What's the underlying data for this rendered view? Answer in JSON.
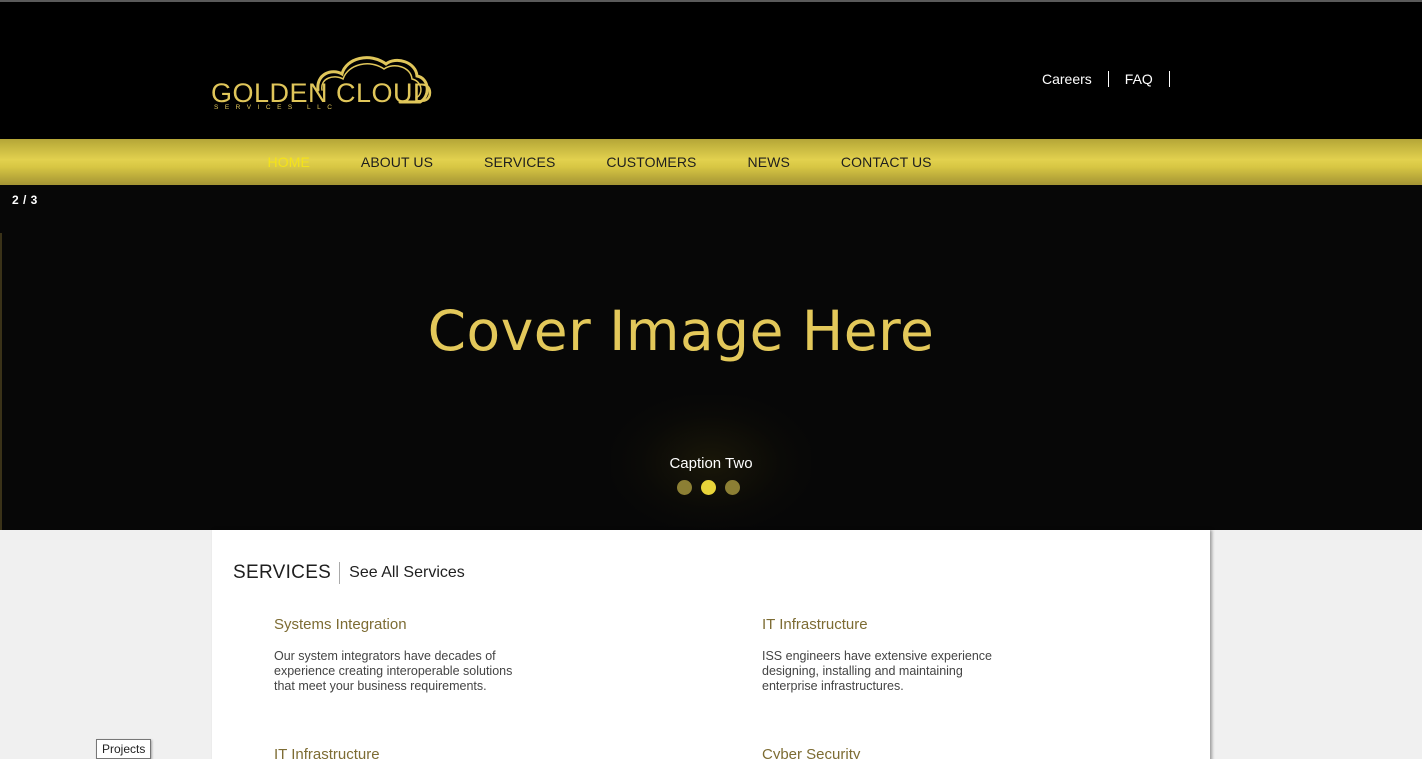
{
  "brand": {
    "name": "GOLDEN CLOUD",
    "sub": "SERVICES LLC",
    "color": "#e0c65a"
  },
  "top_links": [
    "Careers",
    "FAQ"
  ],
  "nav": {
    "items": [
      "HOME",
      "ABOUT US",
      "SERVICES",
      "CUSTOMERS",
      "NEWS",
      "CONTACT US"
    ],
    "active": "HOME"
  },
  "hero": {
    "counter": "2 / 3",
    "title": "Cover Image Here",
    "caption": "Caption Two",
    "slide_count": 3,
    "active_slide": 2
  },
  "services": {
    "title": "SERVICES",
    "see_all": "See All Services",
    "items": [
      {
        "title": "Systems Integration",
        "desc": [
          "Our system integrators have decades of",
          "experience creating interoperable solutions",
          "that meet your business requirements."
        ]
      },
      {
        "title": "IT Infrastructure",
        "desc": [
          "ISS engineers have extensive experience",
          "designing, installing and maintaining",
          "enterprise infrastructures."
        ]
      },
      {
        "title": "IT Infrastructure",
        "desc": []
      },
      {
        "title": "Cyber Security",
        "desc": []
      }
    ]
  },
  "tooltip": "Projects",
  "colors": {
    "accent": "#f4e21a",
    "nav_bar": "#d8c744",
    "service_title": "#7d6c33"
  }
}
